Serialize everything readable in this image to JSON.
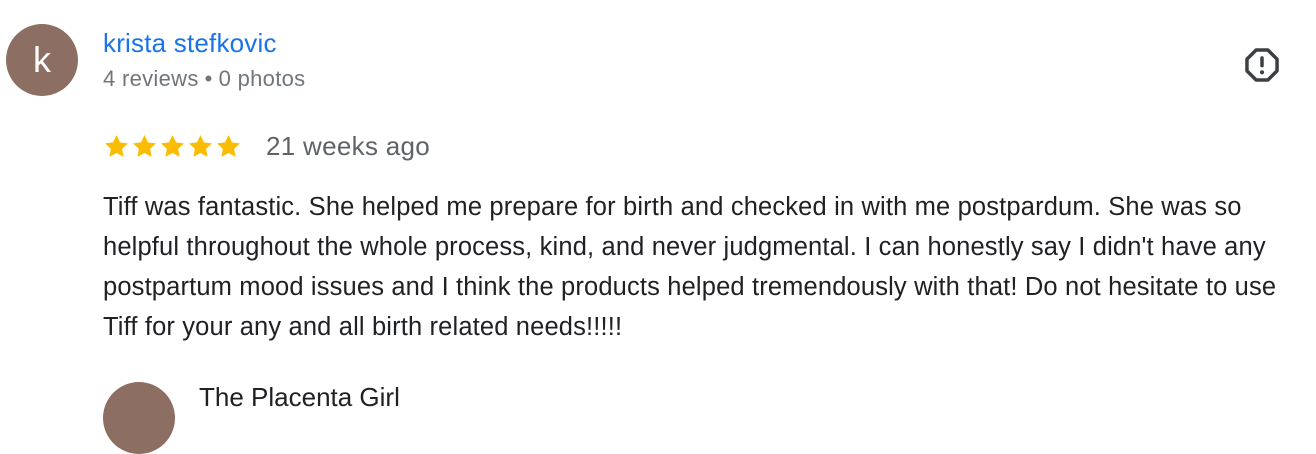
{
  "review": {
    "avatar_initial": "k",
    "author_name": "krista stefkovic",
    "reviews_count": "4 reviews",
    "meta_separator": "•",
    "photos_count": "0 photos",
    "rating": 5,
    "rating_max": 5,
    "date": "21 weeks ago",
    "text": "Tiff was fantastic. She helped me prepare for birth and checked in with me postpardum. She was so helpful throughout the whole process, kind, and never judgmental. I can honestly say I didn't have any postpartum mood issues and I think the products helped tremendously with that! Do not hesitate to use Tiff for your any and all birth related needs!!!!!",
    "flag_icon": "report-flag-icon"
  },
  "owner_reply": {
    "name": "The Placenta Girl"
  },
  "colors": {
    "avatar_bg": "#8d6e63",
    "author_link": "#1a73e8",
    "star": "#fbbc04",
    "meta_text": "#70757a",
    "body_text": "#202124"
  }
}
